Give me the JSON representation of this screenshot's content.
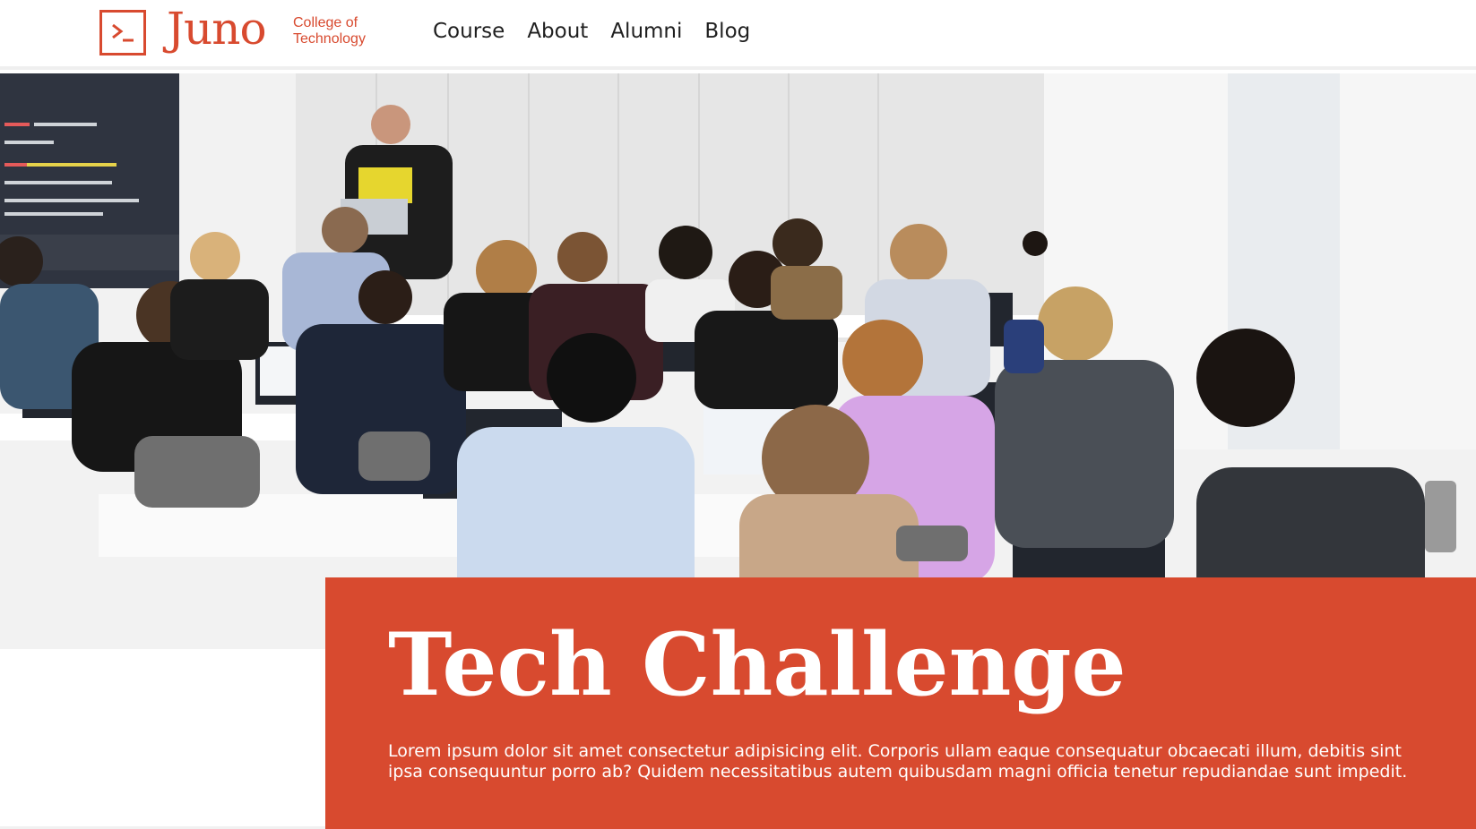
{
  "brand": {
    "name": "Juno",
    "subtitle": "College of Technology",
    "accent": "#d84a2f",
    "icon": "terminal-prompt-icon"
  },
  "nav": {
    "items": [
      "Course",
      "About",
      "Alumni",
      "Blog"
    ]
  },
  "hero": {
    "image": "classroom-photo"
  },
  "card": {
    "title": "Tech Challenge",
    "text": "Lorem ipsum dolor sit amet consectetur adipisicing elit. Corporis ullam eaque consequatur obcaecati illum, debitis sint ipsa consequuntur porro ab? Quidem necessitatibus autem quibusdam magni officia tenetur repudiandae sunt impedit.",
    "background": "#d84a2f"
  }
}
